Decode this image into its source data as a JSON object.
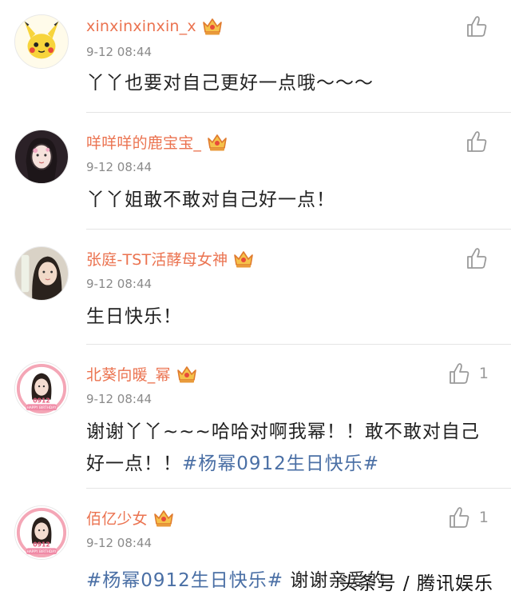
{
  "comments": [
    {
      "username": "xinxinxinxin_x",
      "time": "9-12 08:44",
      "text": "丫丫也要对自己更好一点哦～～～",
      "likes": ""
    },
    {
      "username": "咩咩咩的鹿宝宝_",
      "time": "9-12 08:44",
      "text": "丫丫姐敢不敢对自己好一点！",
      "likes": ""
    },
    {
      "username": "张庭-TST活酵母女神",
      "time": "9-12 08:44",
      "text": "生日快乐！",
      "likes": ""
    },
    {
      "username": "北葵向暖_幂",
      "time": "9-12 08:44",
      "text_plain": "谢谢丫丫~~~哈哈对啊我幂！！敢不敢对自己好一点！！",
      "hashtag": "#杨幂0912生日快乐#",
      "likes": "1"
    },
    {
      "username": "佰亿少女",
      "time": "9-12 08:44",
      "hashtag": "#杨幂0912生日快乐#",
      "text_plain": " 谢谢亲爱的",
      "likes": "1"
    }
  ],
  "avatar_labels": {
    "birthday_number": "0912",
    "birthday_text": "HAPPY BIRTHDAY"
  },
  "watermark": "头条号 / 腾讯娱乐",
  "colors": {
    "username": "#eb7350",
    "hashtag": "#4a6fa5",
    "time": "#8a8a8a",
    "divider": "#e4e4e4"
  },
  "icons": {
    "like": "thumbs-up-icon",
    "vip": "crown-icon"
  }
}
